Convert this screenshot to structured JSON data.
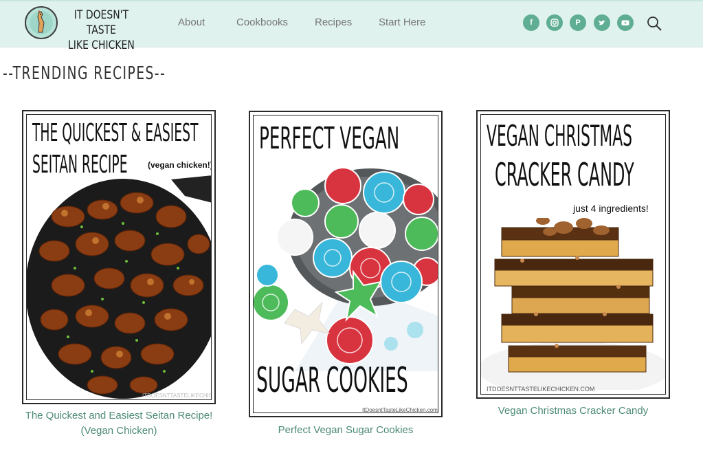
{
  "header": {
    "logo_line1": "IT DOESN'T TASTE",
    "logo_line2": "LIKE CHICKEN",
    "nav": [
      "About",
      "Cookbooks",
      "Recipes",
      "Start Here"
    ],
    "social_icons": [
      "facebook-icon",
      "instagram-icon",
      "pinterest-icon",
      "twitter-icon",
      "youtube-icon"
    ],
    "accent_color": "#5fae93",
    "header_bg": "#dff2ee"
  },
  "section": {
    "title": "--TRENDING RECIPES--"
  },
  "recipes": [
    {
      "pin_line1": "THE QUICKEST & EASIEST",
      "pin_line2": "SEITAN RECIPE",
      "pin_sub": "(vegan chicken!)",
      "watermark": "ITDOESNTTASTELIKECHICKEN.COM",
      "caption": "The Quickest and Easiest Seitan Recipe! (Vegan Chicken)"
    },
    {
      "pin_line1": "PERFECT VEGAN",
      "pin_line2": "SUGAR COOKIES",
      "watermark": "ItDoesntTasteLikeChicken.com",
      "caption": "Perfect Vegan Sugar Cookies"
    },
    {
      "pin_line1": "VEGAN CHRISTMAS",
      "pin_line2": "CRACKER CANDY",
      "pin_sub": "just 4 ingredients!",
      "watermark": "ITDOESNTTASTELIKECHICKEN.COM",
      "caption": "Vegan Christmas Cracker Candy"
    }
  ]
}
